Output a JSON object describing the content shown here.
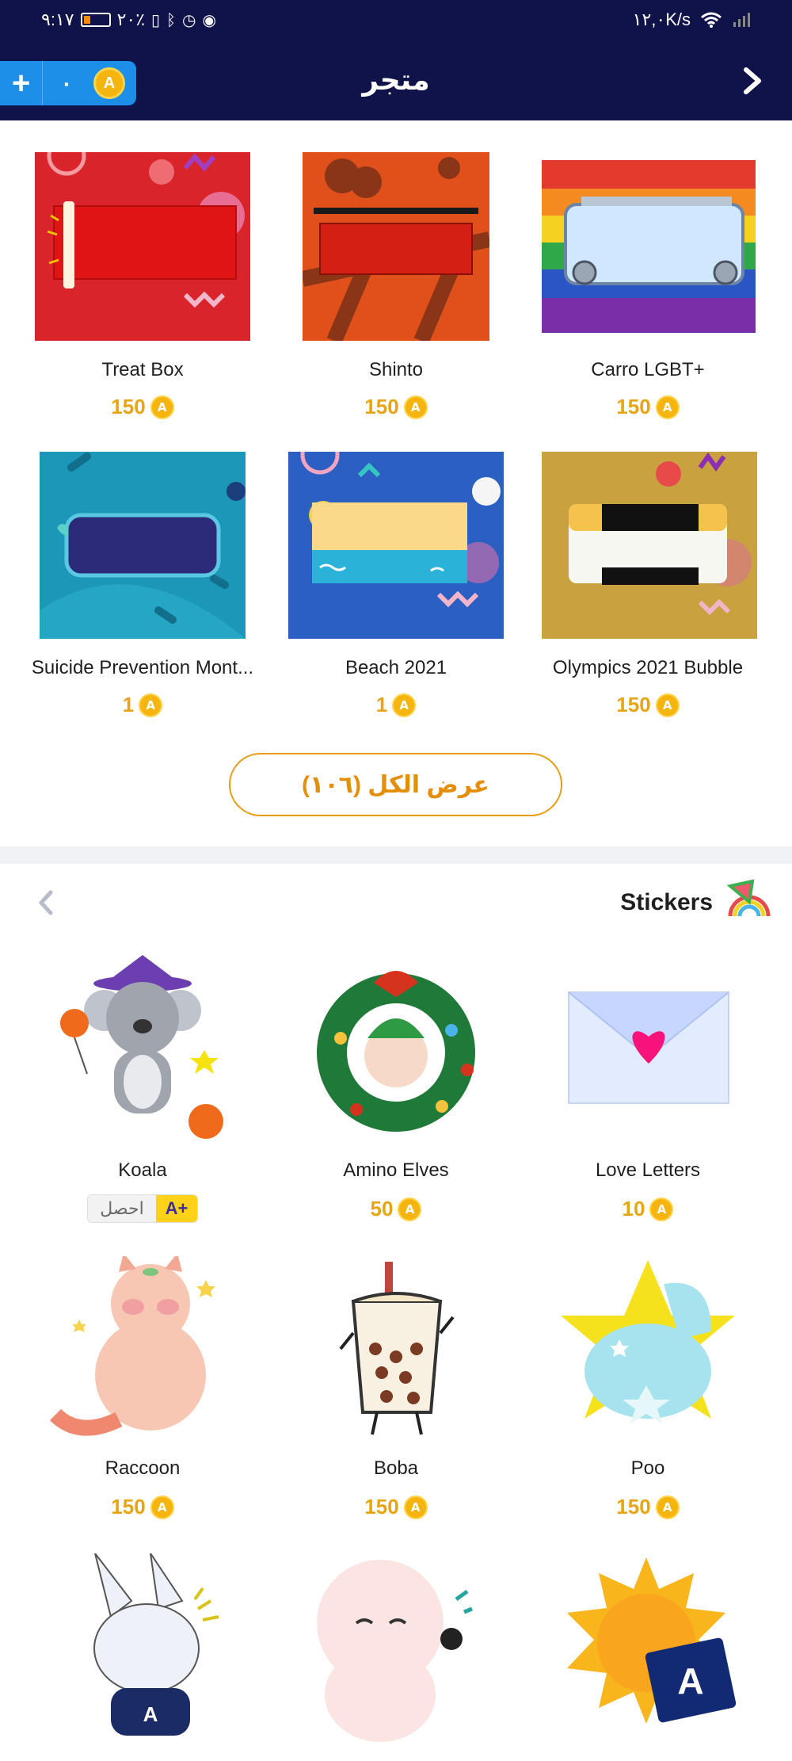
{
  "status_bar": {
    "time": "٩:١٧",
    "battery": "٢٠٪",
    "speed": "١٢,٠K/s"
  },
  "header": {
    "title": "متجر",
    "coin_balance": "٠",
    "plus_label": "+"
  },
  "frames": [
    {
      "name": "Treat Box",
      "price": "150"
    },
    {
      "name": "Shinto",
      "price": "150"
    },
    {
      "name": "Carro LGBT+",
      "price": "150"
    },
    {
      "name": "Suicide Prevention Mont...",
      "price": "1"
    },
    {
      "name": "Beach 2021",
      "price": "1"
    },
    {
      "name": "Olympics 2021 Bubble",
      "price": "150"
    }
  ],
  "view_all": {
    "label": "عرض الكل (١٠٦)"
  },
  "stickers_section": {
    "title": "Stickers",
    "items": [
      {
        "name": "Koala",
        "price": "",
        "badge_get": "احصل",
        "badge_mark": "A+"
      },
      {
        "name": "Amino Elves",
        "price": "50"
      },
      {
        "name": "Love Letters",
        "price": "10"
      },
      {
        "name": "Raccoon",
        "price": "150"
      },
      {
        "name": "Boba",
        "price": "150"
      },
      {
        "name": "Poo",
        "price": "150"
      }
    ]
  },
  "icons": {
    "coin": "amino-coin-icon",
    "back": "chevron-right-icon",
    "prev": "chevron-left-icon",
    "section": "rainbow-watermelon-icon"
  },
  "colors": {
    "header_bg": "#10124a",
    "coin_pill": "#1e8fe8",
    "accent": "#e7a511",
    "view_all_border": "#e79c12"
  }
}
